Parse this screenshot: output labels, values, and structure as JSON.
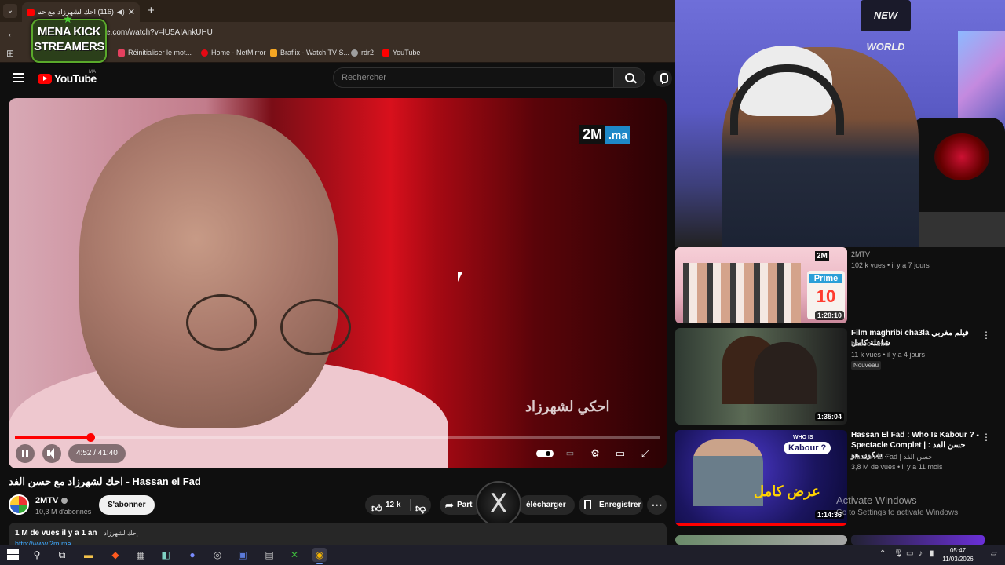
{
  "browser": {
    "tab": {
      "title": "(116) احك لشهرزاد مع حسن",
      "audio_icon": "speaker-icon",
      "close": "✕"
    },
    "new_tab": "+",
    "address": "e.com/watch?v=lU5AIAnkUHU",
    "bookmarks": [
      {
        "label": "Réinitialiser le mot...",
        "color": "#e4405f"
      },
      {
        "label": "Home - NetMirror",
        "color": "#e50914"
      },
      {
        "label": "Braflix - Watch TV S...",
        "color": "#f5a623"
      },
      {
        "label": "rdr2",
        "color": "#9e9e9e"
      },
      {
        "label": "YouTube",
        "color": "#ff0000"
      }
    ]
  },
  "overlay_logo": {
    "line1": "MENA KICK",
    "line2": "STREAMERS"
  },
  "youtube": {
    "logo_text": "YouTube",
    "country": "MA",
    "search_placeholder": "Rechercher"
  },
  "player": {
    "watermark_2m": "2M",
    "watermark_ma": ".ma",
    "show_logo": "احكي لشهرزاد",
    "time": "4:52 / 41:40",
    "progress": 0.1168
  },
  "video": {
    "title": "احك لشهرزاد مع حسن الفد - Hassan el Fad",
    "channel": "2MTV",
    "subscribers": "10,3 M d'abonnés",
    "subscribe_label": "S'abonner",
    "likes": "12 k",
    "share_label": "Part",
    "download_label": "élécharger",
    "save_label": "Enregistrer",
    "more": "⋯",
    "views_meta": "1 M de vues  il y a 1 an",
    "desc_tag": "إحك لشهرزاد",
    "desc_link": "http://www.2m.ma"
  },
  "webcam": {
    "sign": "NEW WORLD"
  },
  "recommendations": [
    {
      "title": "",
      "channel": "2MTV",
      "meta": "102 k vues • il y a 7 jours",
      "duration": "1:28:10",
      "prime": "Prime",
      "episode": "10",
      "logo": "2M"
    },
    {
      "title": "Film maghribi cha3la فيلم مغربي شاعلة كامل",
      "channel": "badoo Tube",
      "meta": "11 k vues • il y a 4 jours",
      "badge": "Nouveau",
      "duration": "1:35:04"
    },
    {
      "title": "Hassan El Fad : Who Is Kabour ? - Spectacle Complet | حسن الفد : شكون هو ...",
      "channel": "Hassan El Fad | حسن الفد",
      "meta": "3,8 M de vues • il y a 11 mois",
      "duration": "1:14:36",
      "who": "WHO IS",
      "kabour": "Kabour ?",
      "arab": "عرض كامل"
    }
  ],
  "activate": {
    "line1": "Activate Windows",
    "line2": "Go to Settings to activate Windows."
  },
  "taskbar": {
    "time": "05:47",
    "date": "11/03/2026"
  }
}
